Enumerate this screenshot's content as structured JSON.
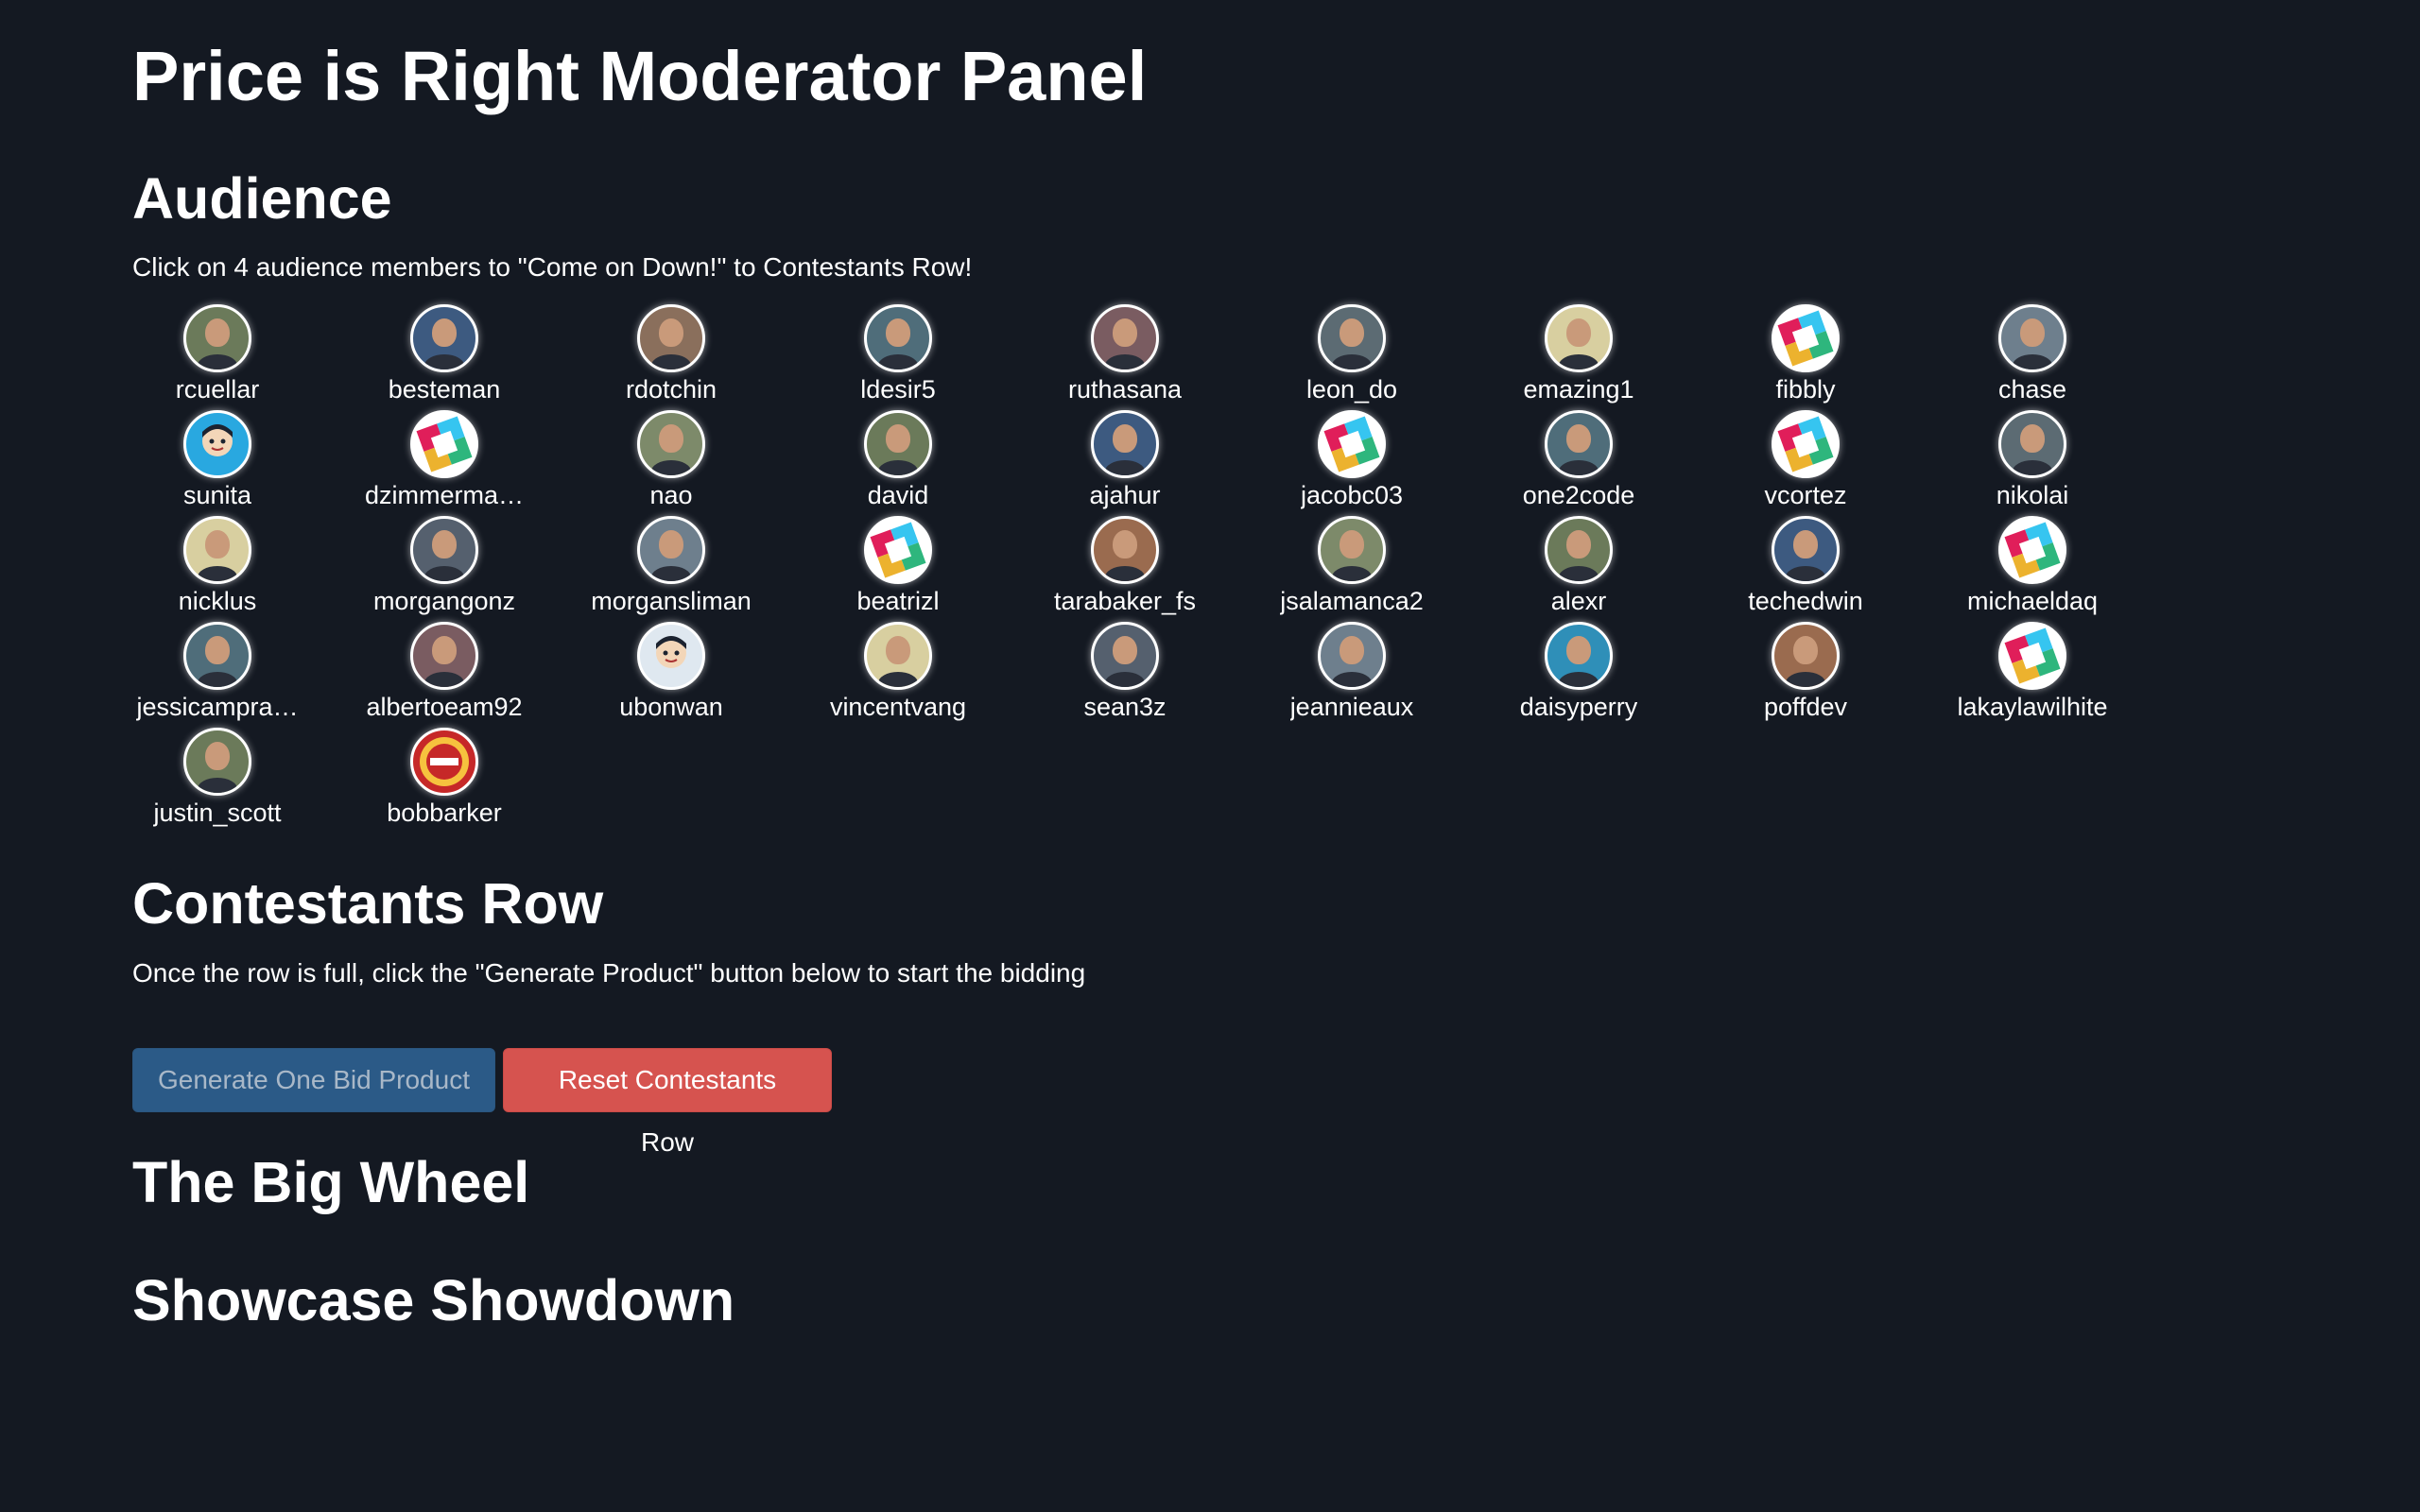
{
  "title": "Price is Right Moderator Panel",
  "audience": {
    "heading": "Audience",
    "instructions": "Click on 4 audience members to \"Come on Down!\" to Contestants Row!",
    "members": [
      {
        "name": "rcuellar",
        "avatar": "photo"
      },
      {
        "name": "besteman",
        "avatar": "photo"
      },
      {
        "name": "rdotchin",
        "avatar": "photo"
      },
      {
        "name": "ldesir5",
        "avatar": "photo"
      },
      {
        "name": "ruthasana",
        "avatar": "photo"
      },
      {
        "name": "leon_do",
        "avatar": "photo"
      },
      {
        "name": "emazing1",
        "avatar": "photo"
      },
      {
        "name": "fibbly",
        "avatar": "slack-logo"
      },
      {
        "name": "chase",
        "avatar": "photo"
      },
      {
        "name": "sunita",
        "avatar": "cartoon"
      },
      {
        "name": "dzimmerma…",
        "avatar": "slack-logo"
      },
      {
        "name": "nao",
        "avatar": "photo"
      },
      {
        "name": "david",
        "avatar": "photo"
      },
      {
        "name": "ajahur",
        "avatar": "photo"
      },
      {
        "name": "jacobc03",
        "avatar": "slack-logo"
      },
      {
        "name": "one2code",
        "avatar": "photo"
      },
      {
        "name": "vcortez",
        "avatar": "slack-logo"
      },
      {
        "name": "nikolai",
        "avatar": "photo"
      },
      {
        "name": "nicklus",
        "avatar": "photo"
      },
      {
        "name": "morgangonz",
        "avatar": "photo"
      },
      {
        "name": "morgansliman",
        "avatar": "photo"
      },
      {
        "name": "beatrizl",
        "avatar": "slack-logo"
      },
      {
        "name": "tarabaker_fs",
        "avatar": "photo"
      },
      {
        "name": "jsalamanca2",
        "avatar": "photo"
      },
      {
        "name": "alexr",
        "avatar": "photo"
      },
      {
        "name": "techedwin",
        "avatar": "photo"
      },
      {
        "name": "michaeldaq",
        "avatar": "slack-logo"
      },
      {
        "name": "jessicampra…",
        "avatar": "photo"
      },
      {
        "name": "albertoeam92",
        "avatar": "photo"
      },
      {
        "name": "ubonwan",
        "avatar": "cartoon"
      },
      {
        "name": "vincentvang",
        "avatar": "photo"
      },
      {
        "name": "sean3z",
        "avatar": "photo"
      },
      {
        "name": "jeannieaux",
        "avatar": "photo"
      },
      {
        "name": "daisyperry",
        "avatar": "photo"
      },
      {
        "name": "poffdev",
        "avatar": "photo"
      },
      {
        "name": "lakaylawilhite",
        "avatar": "slack-logo"
      },
      {
        "name": "justin_scott",
        "avatar": "photo"
      },
      {
        "name": "bobbarker",
        "avatar": "price-is-right-logo"
      }
    ]
  },
  "contestants": {
    "heading": "Contestants Row",
    "instructions": "Once the row is full, click the \"Generate Product\" button below to start the bidding",
    "generate_label": "Generate One Bid Product",
    "reset_label": "Reset Contestants Row"
  },
  "big_wheel": {
    "heading": "The Big Wheel"
  },
  "showcase": {
    "heading": "Showcase Showdown"
  },
  "colors": {
    "background": "#141922",
    "primary_button": "#2b5a87",
    "danger_button": "#d6534f"
  }
}
